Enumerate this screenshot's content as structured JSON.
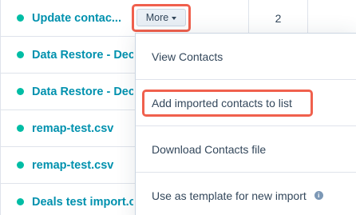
{
  "imports": [
    {
      "name": "Update contac...",
      "count": "2"
    },
    {
      "name": "Data Restore - Dec"
    },
    {
      "name": "Data Restore - Dec"
    },
    {
      "name": "remap-test.csv"
    },
    {
      "name": "remap-test.csv"
    },
    {
      "name": "Deals test import.c"
    }
  ],
  "more_button": {
    "label": "More"
  },
  "menu": {
    "items": [
      {
        "label": "View Contacts"
      },
      {
        "label": "Add imported contacts to list"
      },
      {
        "label": "Download Contacts file"
      },
      {
        "label": "Use as template for new import"
      }
    ],
    "info_icon": "i"
  },
  "colors": {
    "status_dot": "#00bda5",
    "link": "#0091ae",
    "highlight": "#f0604d",
    "text": "#33475b"
  }
}
